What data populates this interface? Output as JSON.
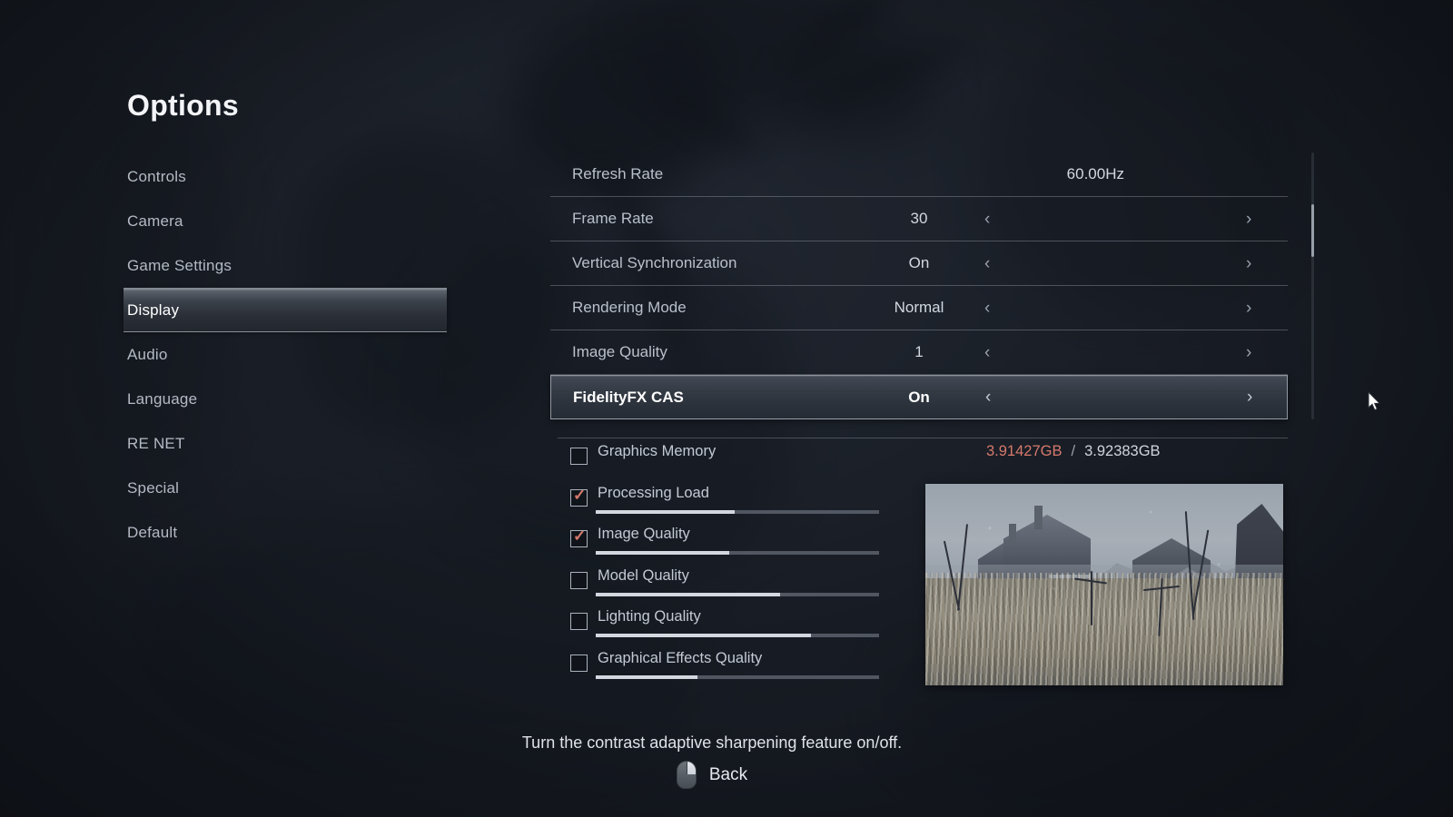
{
  "page": {
    "title": "Options"
  },
  "sidebar": {
    "items": [
      {
        "label": "Controls",
        "selected": false
      },
      {
        "label": "Camera",
        "selected": false
      },
      {
        "label": "Game Settings",
        "selected": false
      },
      {
        "label": "Display",
        "selected": true
      },
      {
        "label": "Audio",
        "selected": false
      },
      {
        "label": "Language",
        "selected": false
      },
      {
        "label": "RE NET",
        "selected": false
      },
      {
        "label": "Special",
        "selected": false
      },
      {
        "label": "Default",
        "selected": false
      }
    ]
  },
  "settings": {
    "rows": [
      {
        "label": "Refresh Rate",
        "value": "60.00Hz",
        "arrows": false,
        "selected": false
      },
      {
        "label": "Frame Rate",
        "value": "30",
        "arrows": true,
        "selected": false
      },
      {
        "label": "Vertical Synchronization",
        "value": "On",
        "arrows": true,
        "selected": false
      },
      {
        "label": "Rendering Mode",
        "value": "Normal",
        "arrows": true,
        "selected": false
      },
      {
        "label": "Image Quality",
        "value": "1",
        "arrows": true,
        "selected": false
      },
      {
        "label": "FidelityFX CAS",
        "value": "On",
        "arrows": true,
        "selected": true
      }
    ],
    "arrow_left": "‹",
    "arrow_right": "›"
  },
  "stats": {
    "memory": {
      "used": "3.91427GB",
      "separator": "/",
      "total": "3.92383GB"
    },
    "rows": [
      {
        "label": "Graphics Memory",
        "checked": false,
        "bar": false,
        "fill_pct": 0
      },
      {
        "label": "Processing Load",
        "checked": true,
        "bar": true,
        "fill_pct": 49
      },
      {
        "label": "Image Quality",
        "checked": true,
        "bar": true,
        "fill_pct": 47
      },
      {
        "label": "Model Quality",
        "checked": false,
        "bar": true,
        "fill_pct": 65
      },
      {
        "label": "Lighting Quality",
        "checked": false,
        "bar": true,
        "fill_pct": 76
      },
      {
        "label": "Graphical Effects Quality",
        "checked": false,
        "bar": true,
        "fill_pct": 36
      }
    ],
    "check_glyph": "✓"
  },
  "preview": {
    "caption": "snowy-village-preview"
  },
  "footer": {
    "hint": "Turn the contrast adaptive sharpening feature on/off.",
    "back_label": "Back"
  },
  "colors": {
    "accent_red": "#d5796c",
    "text_primary": "#e6eaf0",
    "text_secondary": "#b3bac4",
    "background": "#1a1f27"
  }
}
